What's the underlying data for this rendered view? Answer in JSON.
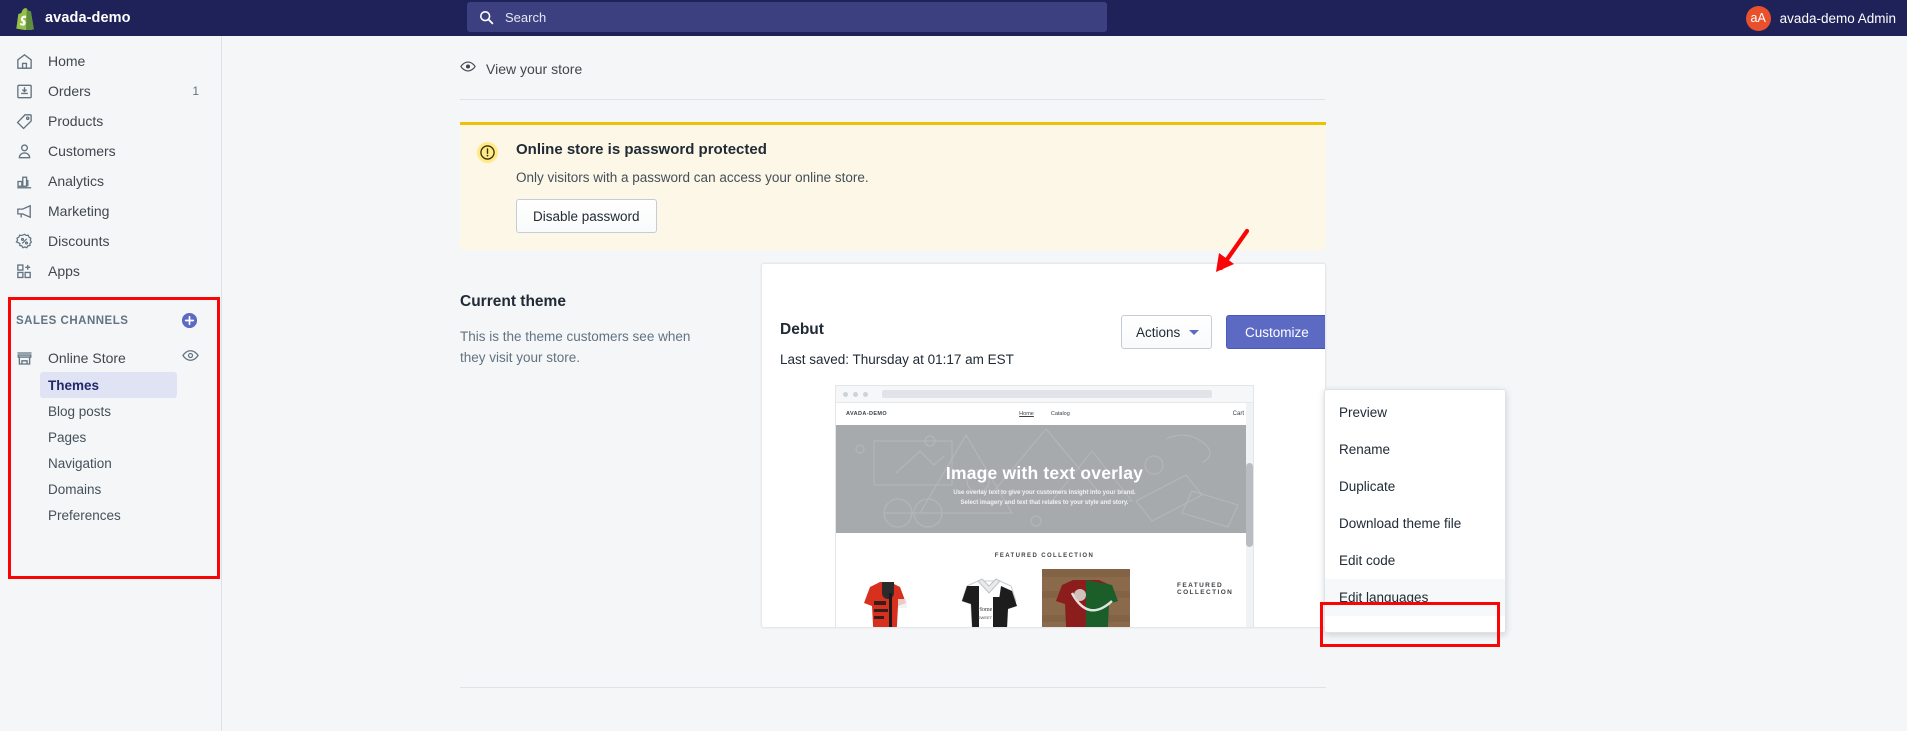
{
  "topbar": {
    "store_name": "avada-demo",
    "search_placeholder": "Search",
    "search_icon": "search-icon",
    "avatar_initials": "aA",
    "user_name": "avada-demo Admin",
    "logo_icon": "shopify-bag-icon",
    "bg_color": "#1f2259",
    "search_bg": "#3d4080",
    "avatar_color": "#e8512b"
  },
  "sidebar": {
    "items": [
      {
        "label": "Home",
        "icon": "home-icon",
        "badge": ""
      },
      {
        "label": "Orders",
        "icon": "orders-inbox-icon",
        "badge": "1"
      },
      {
        "label": "Products",
        "icon": "products-tag-icon",
        "badge": ""
      },
      {
        "label": "Customers",
        "icon": "customers-person-icon",
        "badge": ""
      },
      {
        "label": "Analytics",
        "icon": "analytics-bars-icon",
        "badge": ""
      },
      {
        "label": "Marketing",
        "icon": "marketing-megaphone-icon",
        "badge": ""
      },
      {
        "label": "Discounts",
        "icon": "discounts-percent-icon",
        "badge": ""
      },
      {
        "label": "Apps",
        "icon": "apps-grid-plus-icon",
        "badge": ""
      }
    ],
    "sales_channels": {
      "title": "SALES CHANNELS",
      "add_icon": "plus-circle-icon",
      "store": {
        "label": "Online Store",
        "icon": "storefront-icon",
        "view_icon": "eye-icon"
      },
      "sub_items": [
        {
          "label": "Themes",
          "active": true
        },
        {
          "label": "Blog posts",
          "active": false
        },
        {
          "label": "Pages",
          "active": false
        },
        {
          "label": "Navigation",
          "active": false
        },
        {
          "label": "Domains",
          "active": false
        },
        {
          "label": "Preferences",
          "active": false
        }
      ]
    },
    "highlight_color": "#fa0505"
  },
  "main": {
    "view_store": {
      "label": "View your store",
      "icon": "eye-view-icon"
    },
    "banner": {
      "icon": "alert-exclamation-icon",
      "title": "Online store is password protected",
      "subtitle": "Only visitors with a password can access your online store.",
      "button_label": "Disable password",
      "accent_color": "#eec200",
      "bg_color": "#fcf7e6"
    },
    "current_theme": {
      "heading": "Current theme",
      "description": "This is the theme customers see when they visit your store."
    },
    "theme_card": {
      "name": "Debut",
      "last_saved": "Last saved: Thursday at 01:17 am EST",
      "actions_label": "Actions",
      "actions_caret_icon": "chevron-down-icon",
      "customize_label": "Customize",
      "customize_color": "#5c6ac4"
    },
    "preview": {
      "logo": "AVADA-DEMO",
      "nav": [
        "Home",
        "Catalog"
      ],
      "cart": "Cart",
      "hero_title": "Image with text overlay",
      "hero_sub_line1": "Use overlay text to give your customers insight into your brand.",
      "hero_sub_line2": "Select imagery and text that relates to your style and story.",
      "featured_label": "FEATURED COLLECTION",
      "featured_label_2": "FEATURED COLLECTION"
    },
    "dropdown": {
      "items": [
        {
          "label": "Preview",
          "highlighted": false
        },
        {
          "label": "Rename",
          "highlighted": false
        },
        {
          "label": "Duplicate",
          "highlighted": false
        },
        {
          "label": "Download theme file",
          "highlighted": false
        },
        {
          "label": "Edit code",
          "highlighted": false
        },
        {
          "label": "Edit languages",
          "highlighted": true
        }
      ],
      "highlight_color": "#fa0505"
    },
    "annotation": {
      "arrow_icon": "red-arrow-icon",
      "color": "#fa0505"
    }
  }
}
